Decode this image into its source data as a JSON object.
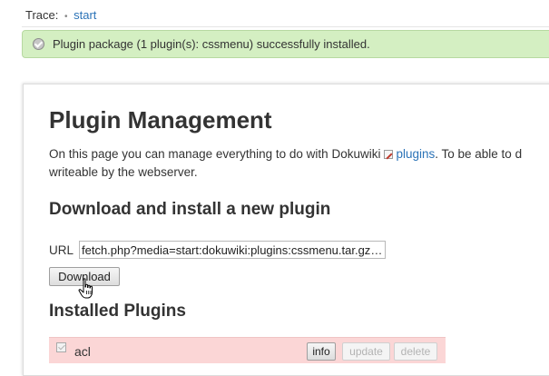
{
  "trace": {
    "label": "Trace:",
    "separator": "•",
    "crumb": "start"
  },
  "message": {
    "icon": "success-check-icon",
    "text": "Plugin package (1 plugin(s): cssmenu) successfully installed."
  },
  "page": {
    "title": "Plugin Management",
    "intro_before": "On this page you can manage everything to do with Dokuwiki",
    "intro_link": "plugins",
    "intro_after": ". To be able to d",
    "intro_line2": "writeable by the webserver."
  },
  "download": {
    "heading": "Download and install a new plugin",
    "url_label": "URL",
    "url_value": "…fetch.php?media=start:dokuwiki:plugins:cssmenu.tar.gz",
    "button_label": "Download"
  },
  "installed": {
    "heading": "Installed Plugins",
    "plugins": [
      {
        "name": "acl",
        "checked": true,
        "info_label": "info",
        "update_label": "update",
        "delete_label": "delete"
      }
    ]
  },
  "colors": {
    "link": "#2b73b7",
    "success_bg": "#d4efc2",
    "plugin_row_bg": "#fbd6d6"
  }
}
